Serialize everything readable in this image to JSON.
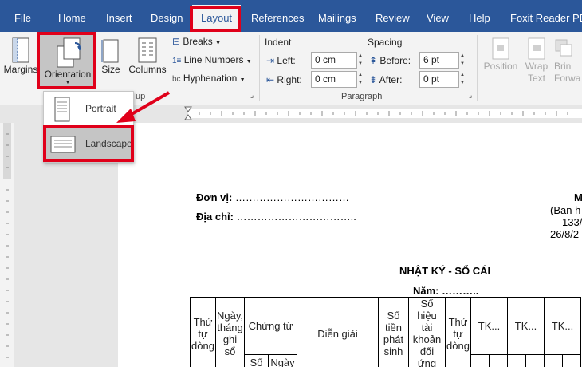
{
  "tabs": [
    {
      "label": "File"
    },
    {
      "label": "Home"
    },
    {
      "label": "Insert"
    },
    {
      "label": "Design"
    },
    {
      "label": "Layout"
    },
    {
      "label": "References"
    },
    {
      "label": "Mailings"
    },
    {
      "label": "Review"
    },
    {
      "label": "View"
    },
    {
      "label": "Help"
    },
    {
      "label": "Foxit Reader PDF"
    }
  ],
  "ribbon": {
    "margins": "Margins",
    "orientation": "Orientation",
    "size": "Size",
    "columns": "Columns",
    "breaks": "Breaks",
    "line_numbers": "Line Numbers",
    "hyphenation": "Hyphenation",
    "setup_group": "up",
    "indent": {
      "title": "Indent",
      "left_label": "Left:",
      "left_value": "0 cm",
      "right_label": "Right:",
      "right_value": "0 cm"
    },
    "spacing": {
      "title": "Spacing",
      "before_label": "Before:",
      "before_value": "6 pt",
      "after_label": "After:",
      "after_value": "0 pt"
    },
    "paragraph_group": "Paragraph",
    "position": "Position",
    "wrap_text_1": "Wrap",
    "wrap_text_2": "Text",
    "bring_forward_1": "Brin",
    "bring_forward_2": "Forwa"
  },
  "orientation_menu": {
    "portrait": "Portrait",
    "landscape": "Landscape"
  },
  "document": {
    "don_vi_label": "Đơn vị:",
    "don_vi_dots": "……………………………",
    "dia_chi_label": "Địa chỉ:",
    "dia_chi_dots": "……………………………..",
    "right_1": "M",
    "right_2": "(Ban h",
    "right_3": "133/",
    "right_4": "26/8/2",
    "title": "NHẬT KÝ - SỔ CÁI",
    "year_label": "Năm:",
    "year_dots": "………..",
    "table": {
      "col_stt": [
        "Thứ",
        "tự",
        "dòng"
      ],
      "col_ngay": [
        "Ngày,",
        "tháng",
        "ghi",
        "sổ"
      ],
      "col_chungtu": "Chứng từ",
      "col_so": "Số",
      "col_ngay2": "Ngày",
      "col_diengiai": "Diễn giải",
      "col_sotien": [
        "Số",
        "tiền",
        "phát",
        "sinh"
      ],
      "col_sohieu": [
        "Số hiệu",
        "tài",
        "khoản",
        "đối ứng"
      ],
      "col_stt2": [
        "Thứ",
        "tự",
        "dòng"
      ],
      "col_tk1": "TK...",
      "col_tk2": "TK...",
      "col_tk3": "TK..."
    }
  },
  "accent_color": "#2b579a",
  "highlight_color": "#e0001a"
}
